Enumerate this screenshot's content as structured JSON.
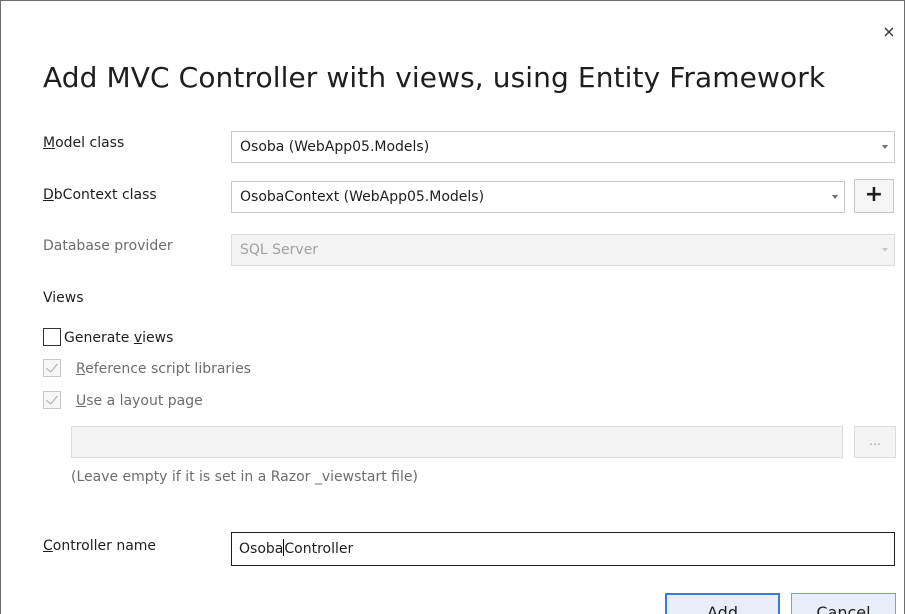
{
  "dialog": {
    "title": "Add MVC Controller with views, using Entity Framework",
    "close_glyph": "×"
  },
  "model_class": {
    "label_mnemonic": "M",
    "label_rest": "odel class",
    "value": "Osoba (WebApp05.Models)"
  },
  "dbcontext_class": {
    "label_mnemonic": "D",
    "label_rest": "bContext class",
    "value": "OsobaContext (WebApp05.Models)",
    "add_label": "+"
  },
  "database_provider": {
    "label": "Database provider",
    "value": "SQL Server"
  },
  "views": {
    "label": "Views",
    "generate_views": {
      "label_pre": "Generate ",
      "label_mnemonic": "v",
      "label_post": "iews",
      "checked": false
    },
    "reference_scripts": {
      "label_mnemonic": "R",
      "label_rest": "eference script libraries",
      "checked": true,
      "disabled": true
    },
    "use_layout": {
      "label_mnemonic": "U",
      "label_rest": "se a layout page",
      "checked": true,
      "disabled": true
    },
    "layout_path": "",
    "browse_label": "...",
    "hint": "(Leave empty if it is set in a Razor _viewstart file)"
  },
  "controller_name": {
    "label_mnemonic": "C",
    "label_rest": "ontroller name",
    "value_before_caret": "Osoba",
    "value_after_caret": "Controller"
  },
  "buttons": {
    "add": "Add",
    "cancel": "Cancel"
  },
  "colors": {
    "accent": "#3d7bd9",
    "button_bg": "#e7eef8",
    "disabled_bg": "#f3f3f3"
  }
}
